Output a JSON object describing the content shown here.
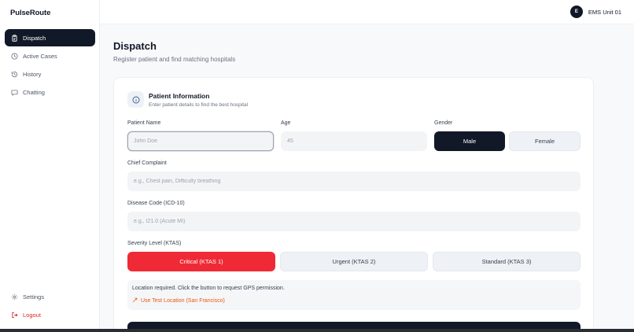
{
  "app": {
    "brand": "PulseRoute"
  },
  "sidebar": {
    "items": [
      {
        "label": "Dispatch",
        "icon": "clipboard-icon",
        "active": true
      },
      {
        "label": "Active Cases",
        "icon": "clock-icon"
      },
      {
        "label": "History",
        "icon": "history-icon"
      },
      {
        "label": "Chatting",
        "icon": "chat-icon"
      }
    ],
    "bottom": [
      {
        "label": "Settings",
        "icon": "gear-icon"
      },
      {
        "label": "Logout",
        "icon": "logout-icon"
      }
    ]
  },
  "user": {
    "initial": "E",
    "name": "EMS Unit 01"
  },
  "page": {
    "title": "Dispatch",
    "subtitle": "Register patient and find matching hospitals"
  },
  "section": {
    "title": "Patient Information",
    "subtitle": "Enter patient details to find the best hospital",
    "icon": "info-icon"
  },
  "form": {
    "patient_name": {
      "label": "Patient Name",
      "value": "",
      "placeholder": "John Doe"
    },
    "age": {
      "label": "Age",
      "value": "",
      "placeholder": "45"
    },
    "gender": {
      "label": "Gender",
      "options": [
        "Male",
        "Female"
      ],
      "selected": "Male"
    },
    "chief_complaint": {
      "label": "Chief Complaint",
      "value": "",
      "placeholder": "e.g., Chest pain, Difficulty breathing"
    },
    "disease_code": {
      "label": "Disease Code (ICD-10)",
      "value": "",
      "placeholder": "e.g., I21.0 (Acute MI)"
    },
    "severity": {
      "label": "Severity Level (KTAS)",
      "options": [
        "Critical (KTAS 1)",
        "Urgent (KTAS 2)",
        "Standard (KTAS 3)"
      ],
      "selected": "Critical (KTAS 1)"
    }
  },
  "location": {
    "message": "Location required. Click the button to request GPS permission.",
    "link": "Use Test Location (San Francisco)"
  },
  "colors": {
    "primary": "#111827",
    "critical": "#ef2a36",
    "link": "#ea580c",
    "logout": "#dc2626"
  }
}
